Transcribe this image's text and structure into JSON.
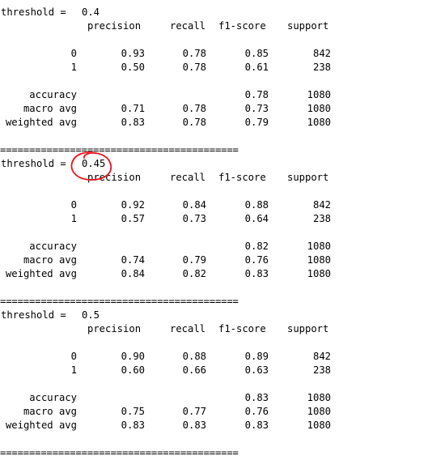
{
  "separator": "=========================================",
  "headers": [
    "precision",
    "recall",
    "f1-score",
    "support"
  ],
  "blocks": [
    {
      "label": "threshold = ",
      "value": "0.4",
      "rows": [
        {
          "name": "0",
          "precision": "0.93",
          "recall": "0.78",
          "f1": "0.85",
          "support": "842"
        },
        {
          "name": "1",
          "precision": "0.50",
          "recall": "0.78",
          "f1": "0.61",
          "support": "238"
        }
      ],
      "summary": [
        {
          "name": "accuracy",
          "precision": "",
          "recall": "",
          "f1": "0.78",
          "support": "1080"
        },
        {
          "name": "macro avg",
          "precision": "0.71",
          "recall": "0.78",
          "f1": "0.73",
          "support": "1080"
        },
        {
          "name": "weighted avg",
          "precision": "0.83",
          "recall": "0.78",
          "f1": "0.79",
          "support": "1080"
        }
      ]
    },
    {
      "label": "threshold = ",
      "value": "0.45",
      "rows": [
        {
          "name": "0",
          "precision": "0.92",
          "recall": "0.84",
          "f1": "0.88",
          "support": "842"
        },
        {
          "name": "1",
          "precision": "0.57",
          "recall": "0.73",
          "f1": "0.64",
          "support": "238"
        }
      ],
      "summary": [
        {
          "name": "accuracy",
          "precision": "",
          "recall": "",
          "f1": "0.82",
          "support": "1080"
        },
        {
          "name": "macro avg",
          "precision": "0.74",
          "recall": "0.79",
          "f1": "0.76",
          "support": "1080"
        },
        {
          "name": "weighted avg",
          "precision": "0.84",
          "recall": "0.82",
          "f1": "0.83",
          "support": "1080"
        }
      ]
    },
    {
      "label": "threshold = ",
      "value": "0.5",
      "rows": [
        {
          "name": "0",
          "precision": "0.90",
          "recall": "0.88",
          "f1": "0.89",
          "support": "842"
        },
        {
          "name": "1",
          "precision": "0.60",
          "recall": "0.66",
          "f1": "0.63",
          "support": "238"
        }
      ],
      "summary": [
        {
          "name": "accuracy",
          "precision": "",
          "recall": "",
          "f1": "0.83",
          "support": "1080"
        },
        {
          "name": "macro avg",
          "precision": "0.75",
          "recall": "0.77",
          "f1": "0.76",
          "support": "1080"
        },
        {
          "name": "weighted avg",
          "precision": "0.83",
          "recall": "0.83",
          "f1": "0.83",
          "support": "1080"
        }
      ]
    }
  ],
  "annotation": {
    "highlighted_block": 1,
    "color": "#e8141c"
  },
  "colors": {
    "background": "#ffffff",
    "text": "#000000"
  }
}
